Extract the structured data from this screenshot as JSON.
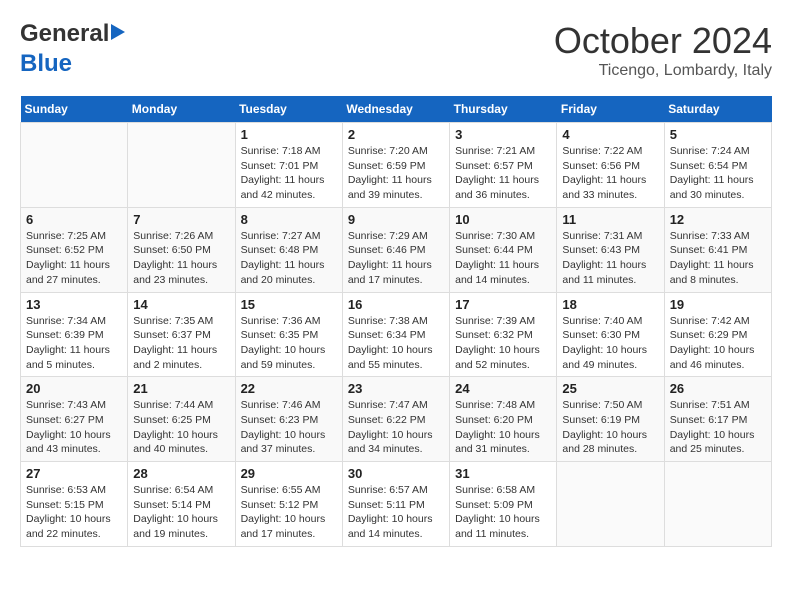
{
  "header": {
    "logo_line1": "General",
    "logo_line2": "Blue",
    "month": "October 2024",
    "location": "Ticengo, Lombardy, Italy"
  },
  "days_of_week": [
    "Sunday",
    "Monday",
    "Tuesday",
    "Wednesday",
    "Thursday",
    "Friday",
    "Saturday"
  ],
  "weeks": [
    [
      {
        "day": "",
        "sunrise": "",
        "sunset": "",
        "daylight": ""
      },
      {
        "day": "",
        "sunrise": "",
        "sunset": "",
        "daylight": ""
      },
      {
        "day": "1",
        "sunrise": "Sunrise: 7:18 AM",
        "sunset": "Sunset: 7:01 PM",
        "daylight": "Daylight: 11 hours and 42 minutes."
      },
      {
        "day": "2",
        "sunrise": "Sunrise: 7:20 AM",
        "sunset": "Sunset: 6:59 PM",
        "daylight": "Daylight: 11 hours and 39 minutes."
      },
      {
        "day": "3",
        "sunrise": "Sunrise: 7:21 AM",
        "sunset": "Sunset: 6:57 PM",
        "daylight": "Daylight: 11 hours and 36 minutes."
      },
      {
        "day": "4",
        "sunrise": "Sunrise: 7:22 AM",
        "sunset": "Sunset: 6:56 PM",
        "daylight": "Daylight: 11 hours and 33 minutes."
      },
      {
        "day": "5",
        "sunrise": "Sunrise: 7:24 AM",
        "sunset": "Sunset: 6:54 PM",
        "daylight": "Daylight: 11 hours and 30 minutes."
      }
    ],
    [
      {
        "day": "6",
        "sunrise": "Sunrise: 7:25 AM",
        "sunset": "Sunset: 6:52 PM",
        "daylight": "Daylight: 11 hours and 27 minutes."
      },
      {
        "day": "7",
        "sunrise": "Sunrise: 7:26 AM",
        "sunset": "Sunset: 6:50 PM",
        "daylight": "Daylight: 11 hours and 23 minutes."
      },
      {
        "day": "8",
        "sunrise": "Sunrise: 7:27 AM",
        "sunset": "Sunset: 6:48 PM",
        "daylight": "Daylight: 11 hours and 20 minutes."
      },
      {
        "day": "9",
        "sunrise": "Sunrise: 7:29 AM",
        "sunset": "Sunset: 6:46 PM",
        "daylight": "Daylight: 11 hours and 17 minutes."
      },
      {
        "day": "10",
        "sunrise": "Sunrise: 7:30 AM",
        "sunset": "Sunset: 6:44 PM",
        "daylight": "Daylight: 11 hours and 14 minutes."
      },
      {
        "day": "11",
        "sunrise": "Sunrise: 7:31 AM",
        "sunset": "Sunset: 6:43 PM",
        "daylight": "Daylight: 11 hours and 11 minutes."
      },
      {
        "day": "12",
        "sunrise": "Sunrise: 7:33 AM",
        "sunset": "Sunset: 6:41 PM",
        "daylight": "Daylight: 11 hours and 8 minutes."
      }
    ],
    [
      {
        "day": "13",
        "sunrise": "Sunrise: 7:34 AM",
        "sunset": "Sunset: 6:39 PM",
        "daylight": "Daylight: 11 hours and 5 minutes."
      },
      {
        "day": "14",
        "sunrise": "Sunrise: 7:35 AM",
        "sunset": "Sunset: 6:37 PM",
        "daylight": "Daylight: 11 hours and 2 minutes."
      },
      {
        "day": "15",
        "sunrise": "Sunrise: 7:36 AM",
        "sunset": "Sunset: 6:35 PM",
        "daylight": "Daylight: 10 hours and 59 minutes."
      },
      {
        "day": "16",
        "sunrise": "Sunrise: 7:38 AM",
        "sunset": "Sunset: 6:34 PM",
        "daylight": "Daylight: 10 hours and 55 minutes."
      },
      {
        "day": "17",
        "sunrise": "Sunrise: 7:39 AM",
        "sunset": "Sunset: 6:32 PM",
        "daylight": "Daylight: 10 hours and 52 minutes."
      },
      {
        "day": "18",
        "sunrise": "Sunrise: 7:40 AM",
        "sunset": "Sunset: 6:30 PM",
        "daylight": "Daylight: 10 hours and 49 minutes."
      },
      {
        "day": "19",
        "sunrise": "Sunrise: 7:42 AM",
        "sunset": "Sunset: 6:29 PM",
        "daylight": "Daylight: 10 hours and 46 minutes."
      }
    ],
    [
      {
        "day": "20",
        "sunrise": "Sunrise: 7:43 AM",
        "sunset": "Sunset: 6:27 PM",
        "daylight": "Daylight: 10 hours and 43 minutes."
      },
      {
        "day": "21",
        "sunrise": "Sunrise: 7:44 AM",
        "sunset": "Sunset: 6:25 PM",
        "daylight": "Daylight: 10 hours and 40 minutes."
      },
      {
        "day": "22",
        "sunrise": "Sunrise: 7:46 AM",
        "sunset": "Sunset: 6:23 PM",
        "daylight": "Daylight: 10 hours and 37 minutes."
      },
      {
        "day": "23",
        "sunrise": "Sunrise: 7:47 AM",
        "sunset": "Sunset: 6:22 PM",
        "daylight": "Daylight: 10 hours and 34 minutes."
      },
      {
        "day": "24",
        "sunrise": "Sunrise: 7:48 AM",
        "sunset": "Sunset: 6:20 PM",
        "daylight": "Daylight: 10 hours and 31 minutes."
      },
      {
        "day": "25",
        "sunrise": "Sunrise: 7:50 AM",
        "sunset": "Sunset: 6:19 PM",
        "daylight": "Daylight: 10 hours and 28 minutes."
      },
      {
        "day": "26",
        "sunrise": "Sunrise: 7:51 AM",
        "sunset": "Sunset: 6:17 PM",
        "daylight": "Daylight: 10 hours and 25 minutes."
      }
    ],
    [
      {
        "day": "27",
        "sunrise": "Sunrise: 6:53 AM",
        "sunset": "Sunset: 5:15 PM",
        "daylight": "Daylight: 10 hours and 22 minutes."
      },
      {
        "day": "28",
        "sunrise": "Sunrise: 6:54 AM",
        "sunset": "Sunset: 5:14 PM",
        "daylight": "Daylight: 10 hours and 19 minutes."
      },
      {
        "day": "29",
        "sunrise": "Sunrise: 6:55 AM",
        "sunset": "Sunset: 5:12 PM",
        "daylight": "Daylight: 10 hours and 17 minutes."
      },
      {
        "day": "30",
        "sunrise": "Sunrise: 6:57 AM",
        "sunset": "Sunset: 5:11 PM",
        "daylight": "Daylight: 10 hours and 14 minutes."
      },
      {
        "day": "31",
        "sunrise": "Sunrise: 6:58 AM",
        "sunset": "Sunset: 5:09 PM",
        "daylight": "Daylight: 10 hours and 11 minutes."
      },
      {
        "day": "",
        "sunrise": "",
        "sunset": "",
        "daylight": ""
      },
      {
        "day": "",
        "sunrise": "",
        "sunset": "",
        "daylight": ""
      }
    ]
  ]
}
